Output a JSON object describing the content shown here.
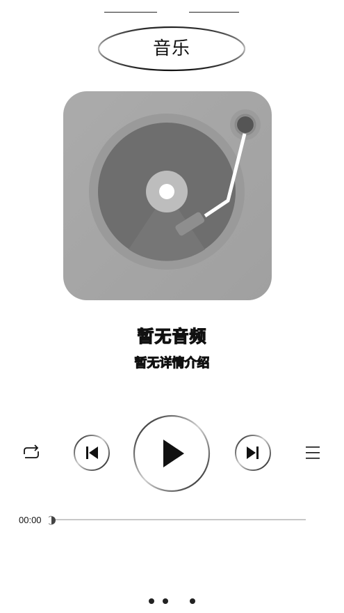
{
  "header": {
    "title": "音乐"
  },
  "album_art": {
    "icon": "vinyl-record-player-icon",
    "colors": {
      "frame": "#a6a6a6",
      "disc": "#6e6e6e",
      "label": "#bdbdbd",
      "tonearm": "#ffffff"
    }
  },
  "track": {
    "title": "暂无音频",
    "description": "暂无详情介绍"
  },
  "controls": {
    "repeat_icon": "repeat-icon",
    "previous_icon": "skip-previous-icon",
    "play_icon": "play-icon",
    "next_icon": "skip-next-icon",
    "playlist_icon": "playlist-icon"
  },
  "progress": {
    "current_time": "00:00",
    "fraction": 0
  },
  "pager": {
    "count": 3
  }
}
